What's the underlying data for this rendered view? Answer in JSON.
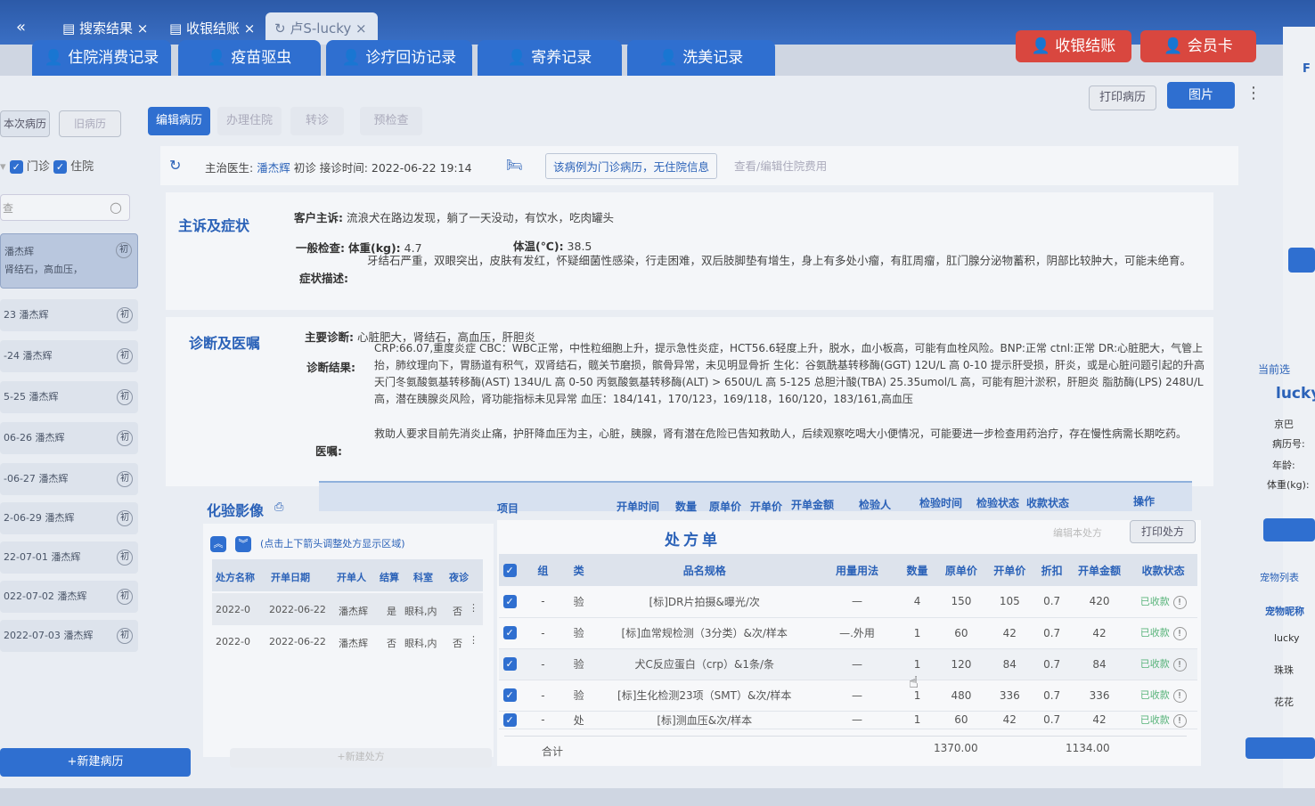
{
  "top_tabs": [
    {
      "label": "搜索结果"
    },
    {
      "label": "收银结账"
    },
    {
      "label": "卢S-lucky"
    }
  ],
  "module_tabs": [
    "住院消费记录",
    "疫苗驱虫",
    "诊疗回访记录",
    "寄养记录",
    "洗美记录"
  ],
  "header_buttons": {
    "cashier": "收银结账",
    "member": "会员卡"
  },
  "toolbar": {
    "print_record": "打印病历",
    "images": "图片"
  },
  "left": {
    "tabs": [
      "本次病历",
      "旧病历"
    ],
    "filters": {
      "outpatient": "门诊",
      "inpatient": "住院"
    },
    "search_placeholder": "查",
    "records": [
      {
        "date": "",
        "doctor": "潘杰辉",
        "summary": "肾结石，高血压，",
        "badge": "初"
      },
      {
        "date": "23",
        "doctor": "潘杰辉",
        "badge": "初"
      },
      {
        "date": "-24",
        "doctor": "潘杰辉",
        "badge": "初"
      },
      {
        "date": "5-25",
        "doctor": "潘杰辉",
        "badge": "初"
      },
      {
        "date": "06-26",
        "doctor": "潘杰辉",
        "badge": "初"
      },
      {
        "date": "-06-27",
        "doctor": "潘杰辉",
        "badge": "初"
      },
      {
        "date": "2-06-29",
        "doctor": "潘杰辉",
        "badge": "初"
      },
      {
        "date": "22-07-01",
        "doctor": "潘杰辉",
        "badge": "初"
      },
      {
        "date": "022-07-02",
        "doctor": "潘杰辉",
        "badge": "初"
      },
      {
        "date": "2022-07-03",
        "doctor": "潘杰辉",
        "badge": "初"
      }
    ],
    "new_record": "+新建病历"
  },
  "action_buttons": [
    "编辑病历",
    "办理住院",
    "转诊",
    "预检查"
  ],
  "visit_info": {
    "doctor_label": "主治医生:",
    "doctor": "潘杰辉",
    "visit_type": "初诊",
    "time_label": "接诊时间:",
    "time": "2022-06-22 19:14",
    "inpatient_note": "该病例为门诊病历，无住院信息",
    "view_costs": "查看/编辑住院费用"
  },
  "complaint": {
    "section": "主诉及症状",
    "client_label": "客户主诉:",
    "client_text": "流浪犬在路边发现，躺了一天没动，有饮水，吃肉罐头",
    "exam_label": "一般检查:",
    "weight_label": "体重(kg):",
    "weight": "4.7",
    "temp_label": "体温(℃):",
    "temp": "38.5",
    "symptom_label": "症状描述:",
    "symptom_text": "牙结石严重，双眼突出，皮肤有发红，怀疑细菌性感染，行走困难，双后肢脚垫有增生，身上有多处小瘤，有肛周瘤，肛门腺分泌物蓄积，阴部比较肿大，可能未绝育。"
  },
  "diagnosis": {
    "section": "诊断及医嘱",
    "main_label": "主要诊断:",
    "main_text": "心脏肥大，肾结石，高血压，肝胆炎",
    "result_label": "诊断结果:",
    "result_text": "CRP:66.07,重度炎症 CBC：WBC正常，中性粒细胞上升，提示急性炎症，HCT56.6轻度上升，脱水，血小板高，可能有血栓风险。BNP:正常 ctnl:正常 DR:心脏肥大，气管上抬，肺纹理向下，胃肠道有积气，双肾结石，髋关节磨损，髌骨异常，未见明显骨折 生化：谷氨酰基转移酶(GGT) 12U/L 高 0-10 提示肝受损，肝炎，或是心脏问题引起的升高 天门冬氨酸氨基转移酶(AST) 134U/L 高 0-50 丙氨酸氨基转移酶(ALT) > 650U/L 高 5-125 总胆汁酸(TBA) 25.35umol/L 高，可能有胆汁淤积，肝胆炎 脂肪酶(LPS) 248U/L 高，潜在胰腺炎风险，肾功能指标未见异常 血压：184/141，170/123，169/118，160/120，183/161,高血压",
    "advice_label": "医嘱:",
    "advice_text": "救助人要求目前先消炎止痛，护肝降血压为主，心脏，胰腺，肾有潜在危险已告知救助人，后续观察吃喝大小便情况，可能要进一步检查用药治疗，存在慢性病需长期吃药。"
  },
  "lab": {
    "section": "化验影像",
    "columns": [
      "项目",
      "开单时间",
      "数量",
      "原单价",
      "开单价",
      "开单金额",
      "检验人",
      "检验时间",
      "检验状态",
      "收款状态",
      "操作"
    ]
  },
  "rx_list": {
    "hint": "(点击上下箭头调整处方显示区域)",
    "columns": [
      "处方名称",
      "开单日期",
      "开单人",
      "结算",
      "科室",
      "夜诊"
    ],
    "rows": [
      {
        "name": "2022-0",
        "date": "2022-06-22",
        "by": "潘杰辉",
        "settled": "是",
        "dept": "眼科,内",
        "night": "否"
      },
      {
        "name": "2022-0",
        "date": "2022-06-22",
        "by": "潘杰辉",
        "settled": "否",
        "dept": "眼科,内",
        "night": "否"
      }
    ],
    "new_rx": "+新建处方"
  },
  "prescription": {
    "title": "处方单",
    "edit_btn": "编辑本处方",
    "print_btn": "打印处方",
    "columns": [
      "组",
      "类",
      "品名规格",
      "用量用法",
      "数量",
      "原单价",
      "开单价",
      "折扣",
      "开单金额",
      "收款状态"
    ],
    "rows": [
      {
        "group": "-",
        "type": "验",
        "name": "[标]DR片拍摄&曝光/次",
        "usage": "—",
        "qty": "4",
        "orig": "150",
        "price": "105",
        "disc": "0.7",
        "amount": "420",
        "status": "已收款"
      },
      {
        "group": "-",
        "type": "验",
        "name": "[标]血常规检测（3分类）&次/样本",
        "usage": "—.外用",
        "qty": "1",
        "orig": "60",
        "price": "42",
        "disc": "0.7",
        "amount": "42",
        "status": "已收款"
      },
      {
        "group": "-",
        "type": "验",
        "name": "犬C反应蛋白（crp）&1条/条",
        "usage": "—",
        "qty": "1",
        "orig": "120",
        "price": "84",
        "disc": "0.7",
        "amount": "84",
        "status": "已收款"
      },
      {
        "group": "-",
        "type": "验",
        "name": "[标]生化检测23项（SMT）&次/样本",
        "usage": "—",
        "qty": "1",
        "orig": "480",
        "price": "336",
        "disc": "0.7",
        "amount": "336",
        "status": "已收款"
      },
      {
        "group": "-",
        "type": "处",
        "name": "[标]测血压&次/样本",
        "usage": "—",
        "qty": "1",
        "orig": "60",
        "price": "42",
        "disc": "0.7",
        "amount": "42",
        "status": "已收款"
      }
    ],
    "total_label": "合计",
    "total_orig": "1370.00",
    "total_amount": "1134.00"
  },
  "right_panel": {
    "current_pet_label": "当前选",
    "pet_name": "lucky",
    "breed": "京巴",
    "record_no_label": "病历号:",
    "age_label": "年龄:",
    "weight_label": "体重(kg):",
    "pet_list_label": "宠物列表",
    "pet_name_col": "宠物昵称",
    "pets": [
      "lucky",
      "珠珠",
      "花花"
    ]
  }
}
